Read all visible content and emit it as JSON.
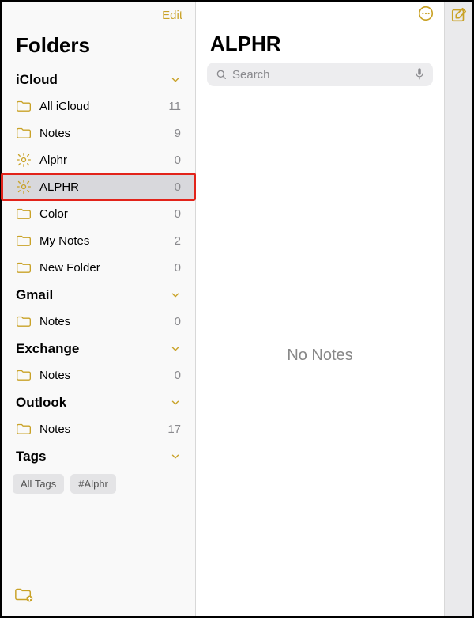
{
  "colors": {
    "accent": "#c9a227",
    "highlight": "#e2231a"
  },
  "sidebar": {
    "edit_label": "Edit",
    "title": "Folders",
    "sections": [
      {
        "id": "icloud",
        "title": "iCloud",
        "items": [
          {
            "icon": "folder",
            "name": "All iCloud",
            "count": 11,
            "selected": false,
            "highlighted": false
          },
          {
            "icon": "folder",
            "name": "Notes",
            "count": 9,
            "selected": false,
            "highlighted": false
          },
          {
            "icon": "gear",
            "name": "Alphr",
            "count": 0,
            "selected": false,
            "highlighted": false
          },
          {
            "icon": "gear",
            "name": "ALPHR",
            "count": 0,
            "selected": true,
            "highlighted": true
          },
          {
            "icon": "folder",
            "name": "Color",
            "count": 0,
            "selected": false,
            "highlighted": false
          },
          {
            "icon": "folder",
            "name": "My Notes",
            "count": 2,
            "selected": false,
            "highlighted": false
          },
          {
            "icon": "folder",
            "name": "New Folder",
            "count": 0,
            "selected": false,
            "highlighted": false
          }
        ]
      },
      {
        "id": "gmail",
        "title": "Gmail",
        "items": [
          {
            "icon": "folder",
            "name": "Notes",
            "count": 0,
            "selected": false,
            "highlighted": false
          }
        ]
      },
      {
        "id": "exchange",
        "title": "Exchange",
        "items": [
          {
            "icon": "folder",
            "name": "Notes",
            "count": 0,
            "selected": false,
            "highlighted": false
          }
        ]
      },
      {
        "id": "outlook",
        "title": "Outlook",
        "items": [
          {
            "icon": "folder",
            "name": "Notes",
            "count": 17,
            "selected": false,
            "highlighted": false
          }
        ]
      }
    ],
    "tags_header": "Tags",
    "tags": [
      "All Tags",
      "#Alphr"
    ]
  },
  "main": {
    "title": "ALPHR",
    "search_placeholder": "Search",
    "empty_text": "No Notes"
  }
}
